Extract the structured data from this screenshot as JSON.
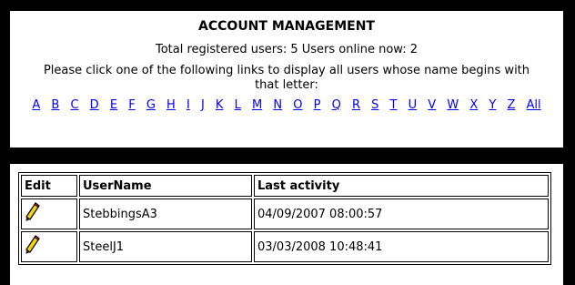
{
  "header": {
    "title": "ACCOUNT MANAGEMENT",
    "counts": "Total registered users: 5 Users online now: 2",
    "instruction": "Please click one of the following links to display all users whose name begins with that letter:"
  },
  "letters": [
    "A",
    "B",
    "C",
    "D",
    "E",
    "F",
    "G",
    "H",
    "I",
    "J",
    "K",
    "L",
    "M",
    "N",
    "O",
    "P",
    "Q",
    "R",
    "S",
    "T",
    "U",
    "V",
    "W",
    "X",
    "Y",
    "Z",
    "All"
  ],
  "table": {
    "columns": [
      "Edit",
      "UserName",
      "Last activity"
    ],
    "rows": [
      {
        "edit_icon": "pencil-icon",
        "username": "StebbingsA3",
        "last_activity": "04/09/2007 08:00:57"
      },
      {
        "edit_icon": "pencil-icon",
        "username": "SteelJ1",
        "last_activity": "03/03/2008 10:48:41"
      }
    ]
  },
  "colors": {
    "background_frame": "#000000",
    "link": "#0000ee",
    "panel": "#ffffff"
  }
}
